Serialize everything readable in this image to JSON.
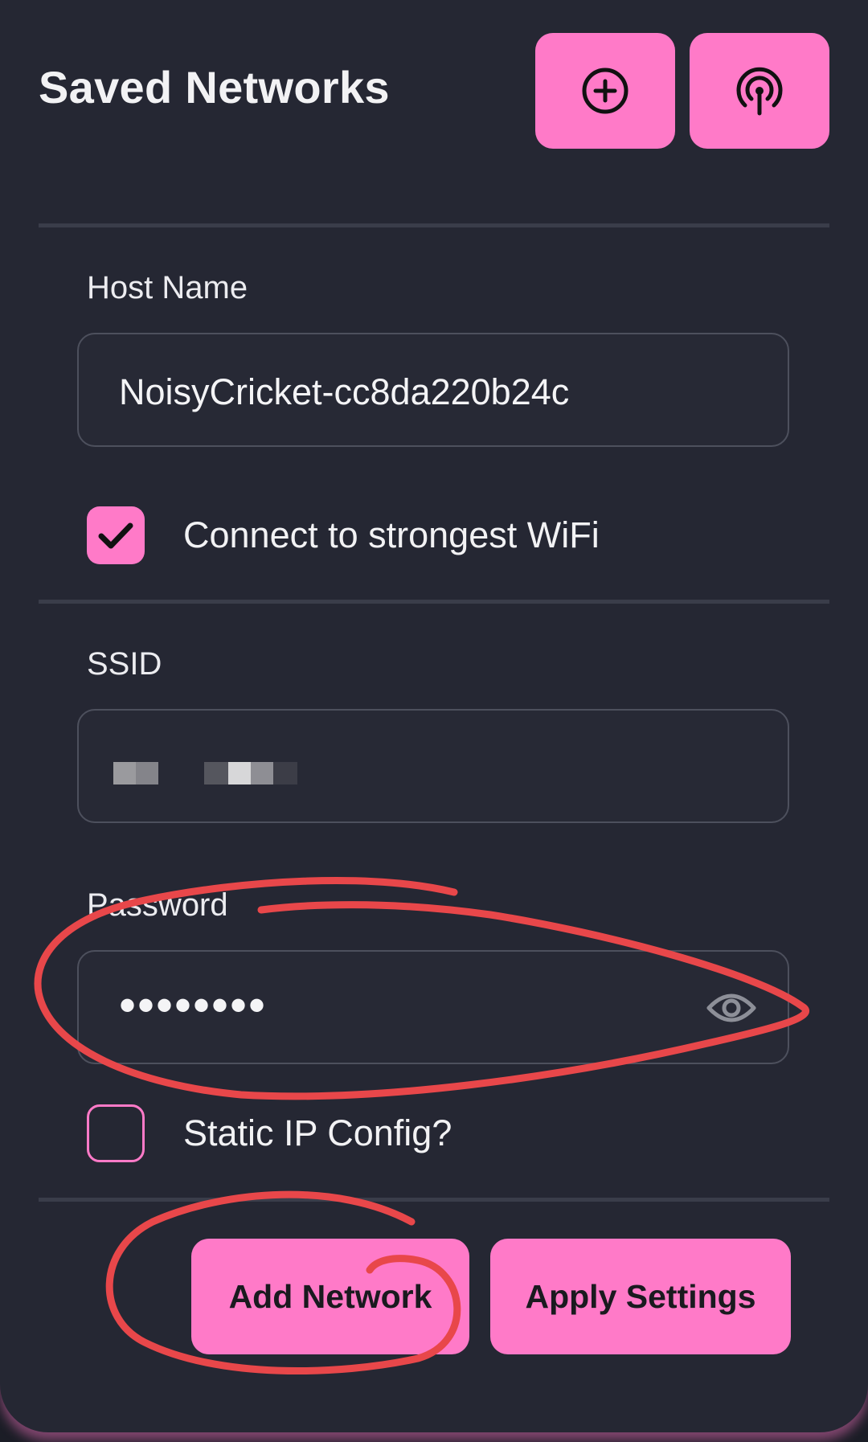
{
  "header": {
    "title": "Saved Networks",
    "add_icon": "plus-circle-icon",
    "scan_icon": "wifi-broadcast-icon"
  },
  "host_name": {
    "label": "Host Name",
    "value": "NoisyCricket-cc8da220b24c"
  },
  "strongest_wifi": {
    "label": "Connect to strongest WiFi",
    "checked": true
  },
  "ssid": {
    "label": "SSID"
  },
  "password": {
    "label": "Password",
    "masked_value": "••••••••",
    "visibility_icon": "eye-icon"
  },
  "static_ip": {
    "label": "Static IP Config?",
    "checked": false
  },
  "actions": {
    "add_network": "Add Network",
    "apply_settings": "Apply Settings"
  },
  "colors": {
    "background": "#252733",
    "accent": "#ff7ac8",
    "text": "#f2f2f4",
    "annotation": "#e8474a"
  }
}
